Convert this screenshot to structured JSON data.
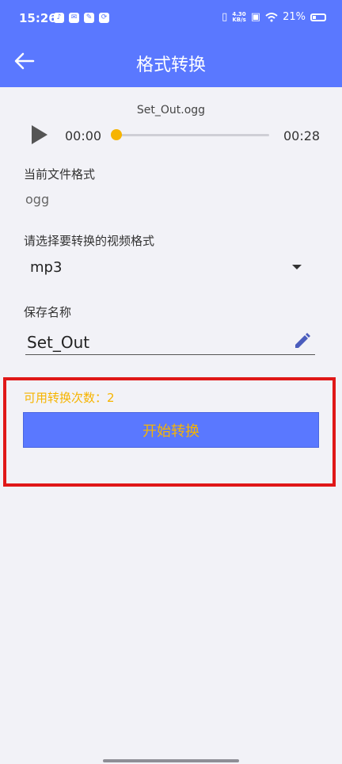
{
  "status_bar": {
    "time": "15:26",
    "app_icons": [
      "tiktok-icon",
      "mail-icon",
      "notes-icon",
      "sync-icon"
    ],
    "network_speed_top": "4.30",
    "network_speed_bottom": "KB/s",
    "battery": "21%"
  },
  "app_bar": {
    "title": "格式转换"
  },
  "player": {
    "file_name": "Set_Out.ogg",
    "current_time": "00:00",
    "total_time": "00:28",
    "progress": 0.0
  },
  "form": {
    "current_format_label": "当前文件格式",
    "current_format_value": "ogg",
    "target_format_label": "请选择要转换的视频格式",
    "target_format_value": "mp3",
    "save_name_label": "保存名称",
    "save_name_value": "Set_Out"
  },
  "convert": {
    "available_text": "可用转换次数：2",
    "start_label": "开始转换"
  },
  "colors": {
    "accent": "#5a78ff",
    "highlight": "#f6b400",
    "annotation_box": "#e01818",
    "background": "#f2f2f7"
  }
}
